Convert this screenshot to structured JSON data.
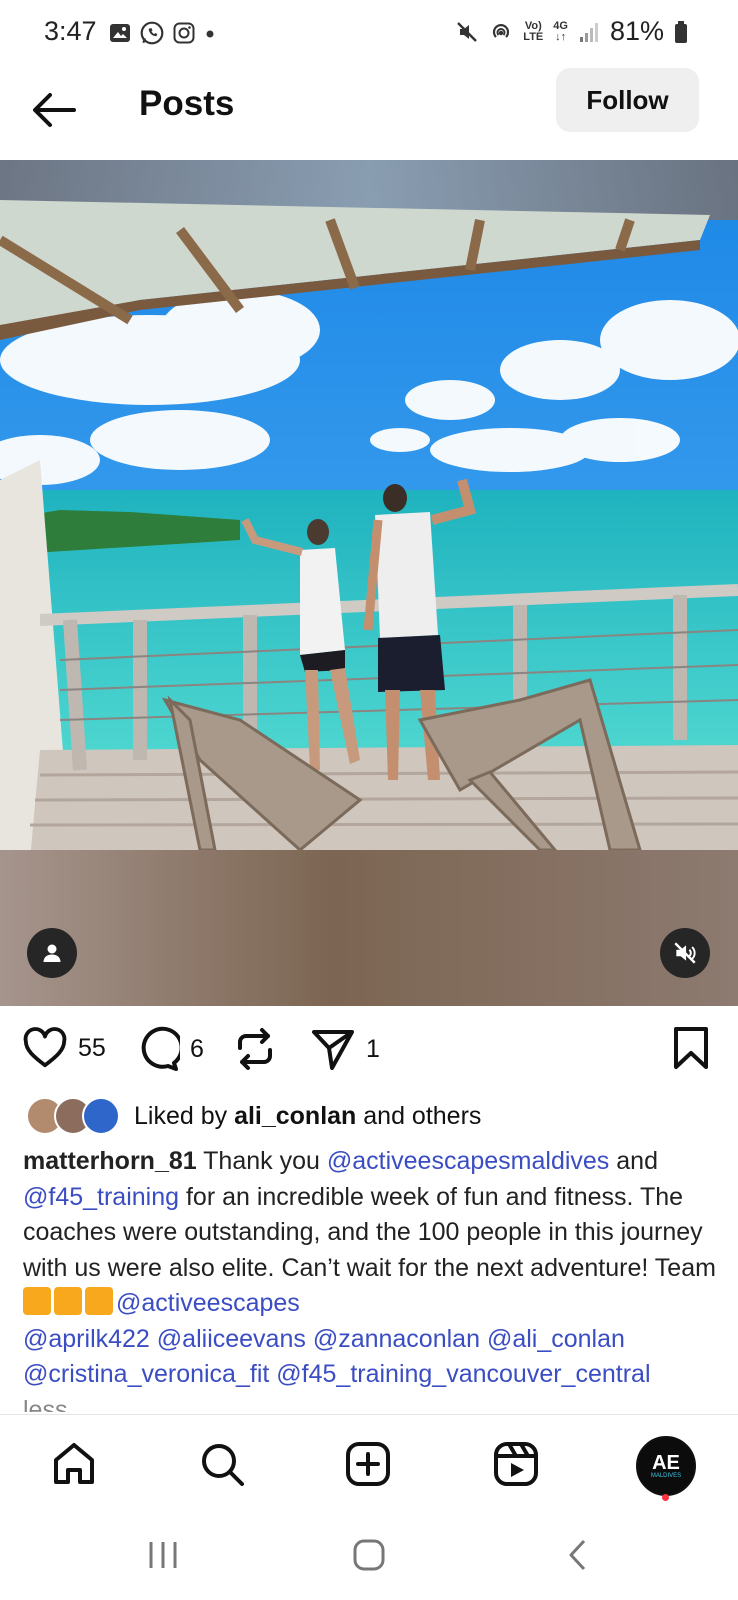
{
  "status_bar": {
    "time": "3:47",
    "battery": "81%",
    "network_lte": "LTE",
    "network_vo": "Vo)",
    "network_4g": "4G"
  },
  "header": {
    "title": "Posts",
    "follow_label": "Follow"
  },
  "actions": {
    "like_count": "55",
    "comment_count": "6",
    "share_count": "1"
  },
  "likes": {
    "prefix": "Liked by ",
    "user": "ali_conlan",
    "suffix": " and others"
  },
  "caption": {
    "author": "matterhorn_81",
    "t1": " Thank you ",
    "m1": "@activeescapesmaldives",
    "t2": " and ",
    "m2": "@f45_training",
    "t3": " for an incredible week of fun and fitness. The coaches were outstanding, and the 100 people in this journey with us were also elite. Can’t wait for the next adventure! Team ",
    "m3": "@activeescapes",
    "m4": "@aprilk422",
    "m5": "@aliiceevans",
    "m6": "@zannaconlan",
    "m7": "@ali_conlan",
    "m8": "@cristina_veronica_fit",
    "m9": "@f45_training_vancouver_central",
    "more": "less"
  },
  "profile_avatar": {
    "monogram": "AE",
    "subtitle": "MALDIVES"
  },
  "colors": {
    "mention": "#3b4dc2",
    "follow_bg": "#efefef",
    "notification_dot": "#ff3040"
  },
  "icons": {
    "back": "arrow-left-icon",
    "like": "heart-icon",
    "comment": "comment-icon",
    "repost": "repost-icon",
    "share": "send-icon",
    "save": "bookmark-icon",
    "tag": "person-icon",
    "mute": "speaker-muted-icon",
    "home": "home-icon",
    "search": "search-icon",
    "create": "plus-square-icon",
    "reels": "reels-icon"
  }
}
